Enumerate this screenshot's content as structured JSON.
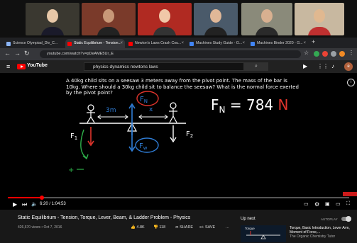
{
  "browser": {
    "tabs": [
      {
        "label": "Science Olympiad_Div_C..."
      },
      {
        "label": "Static Equilibrium - Tension..."
      },
      {
        "label": "Newton's Laws Crash Cou..."
      },
      {
        "label": "Machines Study Guide - G..."
      },
      {
        "label": "Machines Binder 2020 - G..."
      }
    ],
    "new_tab": "+",
    "url": "youtube.com/watch?v=pDeAME5Ur_E"
  },
  "youtube": {
    "logo": "YouTube",
    "search_value": "physics dynamics newtons laws"
  },
  "video": {
    "problem_text": "A 40kg child sits on a seesaw 3 meters away from the pivot point. The mass of the bar is 10kg. Where should a 30kg child sit to balance the seesaw? What is the normal force exerted by the pivot point?",
    "answer_label": "F",
    "answer_sub": "N",
    "answer_rest": " = 784 ",
    "answer_unit": "N",
    "fn_label": "F",
    "fn_sub": "N",
    "fw_label": "F",
    "fw_sub": "w",
    "f1_label": "F",
    "f1_sub": "1",
    "f2_label": "F",
    "f2_sub": "2",
    "dist_label": "3m",
    "x_label": "x",
    "time": "6:20 / 1:04:53",
    "progress_fraction": 0.1
  },
  "below": {
    "title": "Static Equilibrium - Tension, Torque, Lever, Beam, & Ladder Problem - Physics",
    "meta": "426,670 views • Oct 7, 2016",
    "likes": "4.8K",
    "dislikes": "118",
    "share": "SHARE",
    "save": "SAVE",
    "more": "...",
    "up_next": "Up next",
    "autoplay": "AUTOPLAY",
    "rec_thumb_title": "Torque",
    "rec_title": "Torque, Basic Introduction, Lever Arm, Moment of Force,...",
    "rec_channel": "The Organic Chemistry Tutor"
  },
  "colors": {
    "youtube_red": "#ff0000",
    "ink_blue": "#2f7dd6",
    "ink_red": "#e0342c",
    "ink_green": "#2db04a"
  }
}
